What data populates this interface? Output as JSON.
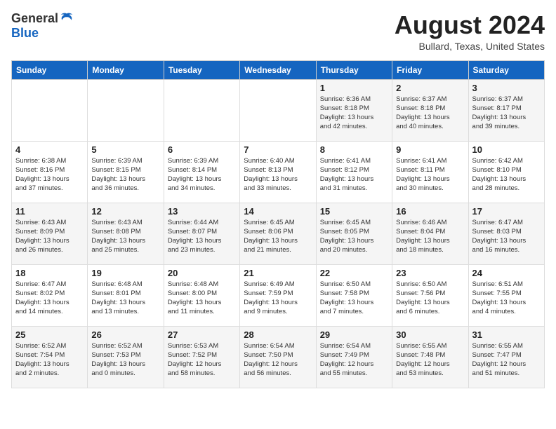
{
  "logo": {
    "general": "General",
    "blue": "Blue"
  },
  "header": {
    "month": "August 2024",
    "location": "Bullard, Texas, United States"
  },
  "days_of_week": [
    "Sunday",
    "Monday",
    "Tuesday",
    "Wednesday",
    "Thursday",
    "Friday",
    "Saturday"
  ],
  "weeks": [
    [
      {
        "day": "",
        "info": ""
      },
      {
        "day": "",
        "info": ""
      },
      {
        "day": "",
        "info": ""
      },
      {
        "day": "",
        "info": ""
      },
      {
        "day": "1",
        "info": "Sunrise: 6:36 AM\nSunset: 8:18 PM\nDaylight: 13 hours\nand 42 minutes."
      },
      {
        "day": "2",
        "info": "Sunrise: 6:37 AM\nSunset: 8:18 PM\nDaylight: 13 hours\nand 40 minutes."
      },
      {
        "day": "3",
        "info": "Sunrise: 6:37 AM\nSunset: 8:17 PM\nDaylight: 13 hours\nand 39 minutes."
      }
    ],
    [
      {
        "day": "4",
        "info": "Sunrise: 6:38 AM\nSunset: 8:16 PM\nDaylight: 13 hours\nand 37 minutes."
      },
      {
        "day": "5",
        "info": "Sunrise: 6:39 AM\nSunset: 8:15 PM\nDaylight: 13 hours\nand 36 minutes."
      },
      {
        "day": "6",
        "info": "Sunrise: 6:39 AM\nSunset: 8:14 PM\nDaylight: 13 hours\nand 34 minutes."
      },
      {
        "day": "7",
        "info": "Sunrise: 6:40 AM\nSunset: 8:13 PM\nDaylight: 13 hours\nand 33 minutes."
      },
      {
        "day": "8",
        "info": "Sunrise: 6:41 AM\nSunset: 8:12 PM\nDaylight: 13 hours\nand 31 minutes."
      },
      {
        "day": "9",
        "info": "Sunrise: 6:41 AM\nSunset: 8:11 PM\nDaylight: 13 hours\nand 30 minutes."
      },
      {
        "day": "10",
        "info": "Sunrise: 6:42 AM\nSunset: 8:10 PM\nDaylight: 13 hours\nand 28 minutes."
      }
    ],
    [
      {
        "day": "11",
        "info": "Sunrise: 6:43 AM\nSunset: 8:09 PM\nDaylight: 13 hours\nand 26 minutes."
      },
      {
        "day": "12",
        "info": "Sunrise: 6:43 AM\nSunset: 8:08 PM\nDaylight: 13 hours\nand 25 minutes."
      },
      {
        "day": "13",
        "info": "Sunrise: 6:44 AM\nSunset: 8:07 PM\nDaylight: 13 hours\nand 23 minutes."
      },
      {
        "day": "14",
        "info": "Sunrise: 6:45 AM\nSunset: 8:06 PM\nDaylight: 13 hours\nand 21 minutes."
      },
      {
        "day": "15",
        "info": "Sunrise: 6:45 AM\nSunset: 8:05 PM\nDaylight: 13 hours\nand 20 minutes."
      },
      {
        "day": "16",
        "info": "Sunrise: 6:46 AM\nSunset: 8:04 PM\nDaylight: 13 hours\nand 18 minutes."
      },
      {
        "day": "17",
        "info": "Sunrise: 6:47 AM\nSunset: 8:03 PM\nDaylight: 13 hours\nand 16 minutes."
      }
    ],
    [
      {
        "day": "18",
        "info": "Sunrise: 6:47 AM\nSunset: 8:02 PM\nDaylight: 13 hours\nand 14 minutes."
      },
      {
        "day": "19",
        "info": "Sunrise: 6:48 AM\nSunset: 8:01 PM\nDaylight: 13 hours\nand 13 minutes."
      },
      {
        "day": "20",
        "info": "Sunrise: 6:48 AM\nSunset: 8:00 PM\nDaylight: 13 hours\nand 11 minutes."
      },
      {
        "day": "21",
        "info": "Sunrise: 6:49 AM\nSunset: 7:59 PM\nDaylight: 13 hours\nand 9 minutes."
      },
      {
        "day": "22",
        "info": "Sunrise: 6:50 AM\nSunset: 7:58 PM\nDaylight: 13 hours\nand 7 minutes."
      },
      {
        "day": "23",
        "info": "Sunrise: 6:50 AM\nSunset: 7:56 PM\nDaylight: 13 hours\nand 6 minutes."
      },
      {
        "day": "24",
        "info": "Sunrise: 6:51 AM\nSunset: 7:55 PM\nDaylight: 13 hours\nand 4 minutes."
      }
    ],
    [
      {
        "day": "25",
        "info": "Sunrise: 6:52 AM\nSunset: 7:54 PM\nDaylight: 13 hours\nand 2 minutes."
      },
      {
        "day": "26",
        "info": "Sunrise: 6:52 AM\nSunset: 7:53 PM\nDaylight: 13 hours\nand 0 minutes."
      },
      {
        "day": "27",
        "info": "Sunrise: 6:53 AM\nSunset: 7:52 PM\nDaylight: 12 hours\nand 58 minutes."
      },
      {
        "day": "28",
        "info": "Sunrise: 6:54 AM\nSunset: 7:50 PM\nDaylight: 12 hours\nand 56 minutes."
      },
      {
        "day": "29",
        "info": "Sunrise: 6:54 AM\nSunset: 7:49 PM\nDaylight: 12 hours\nand 55 minutes."
      },
      {
        "day": "30",
        "info": "Sunrise: 6:55 AM\nSunset: 7:48 PM\nDaylight: 12 hours\nand 53 minutes."
      },
      {
        "day": "31",
        "info": "Sunrise: 6:55 AM\nSunset: 7:47 PM\nDaylight: 12 hours\nand 51 minutes."
      }
    ]
  ]
}
